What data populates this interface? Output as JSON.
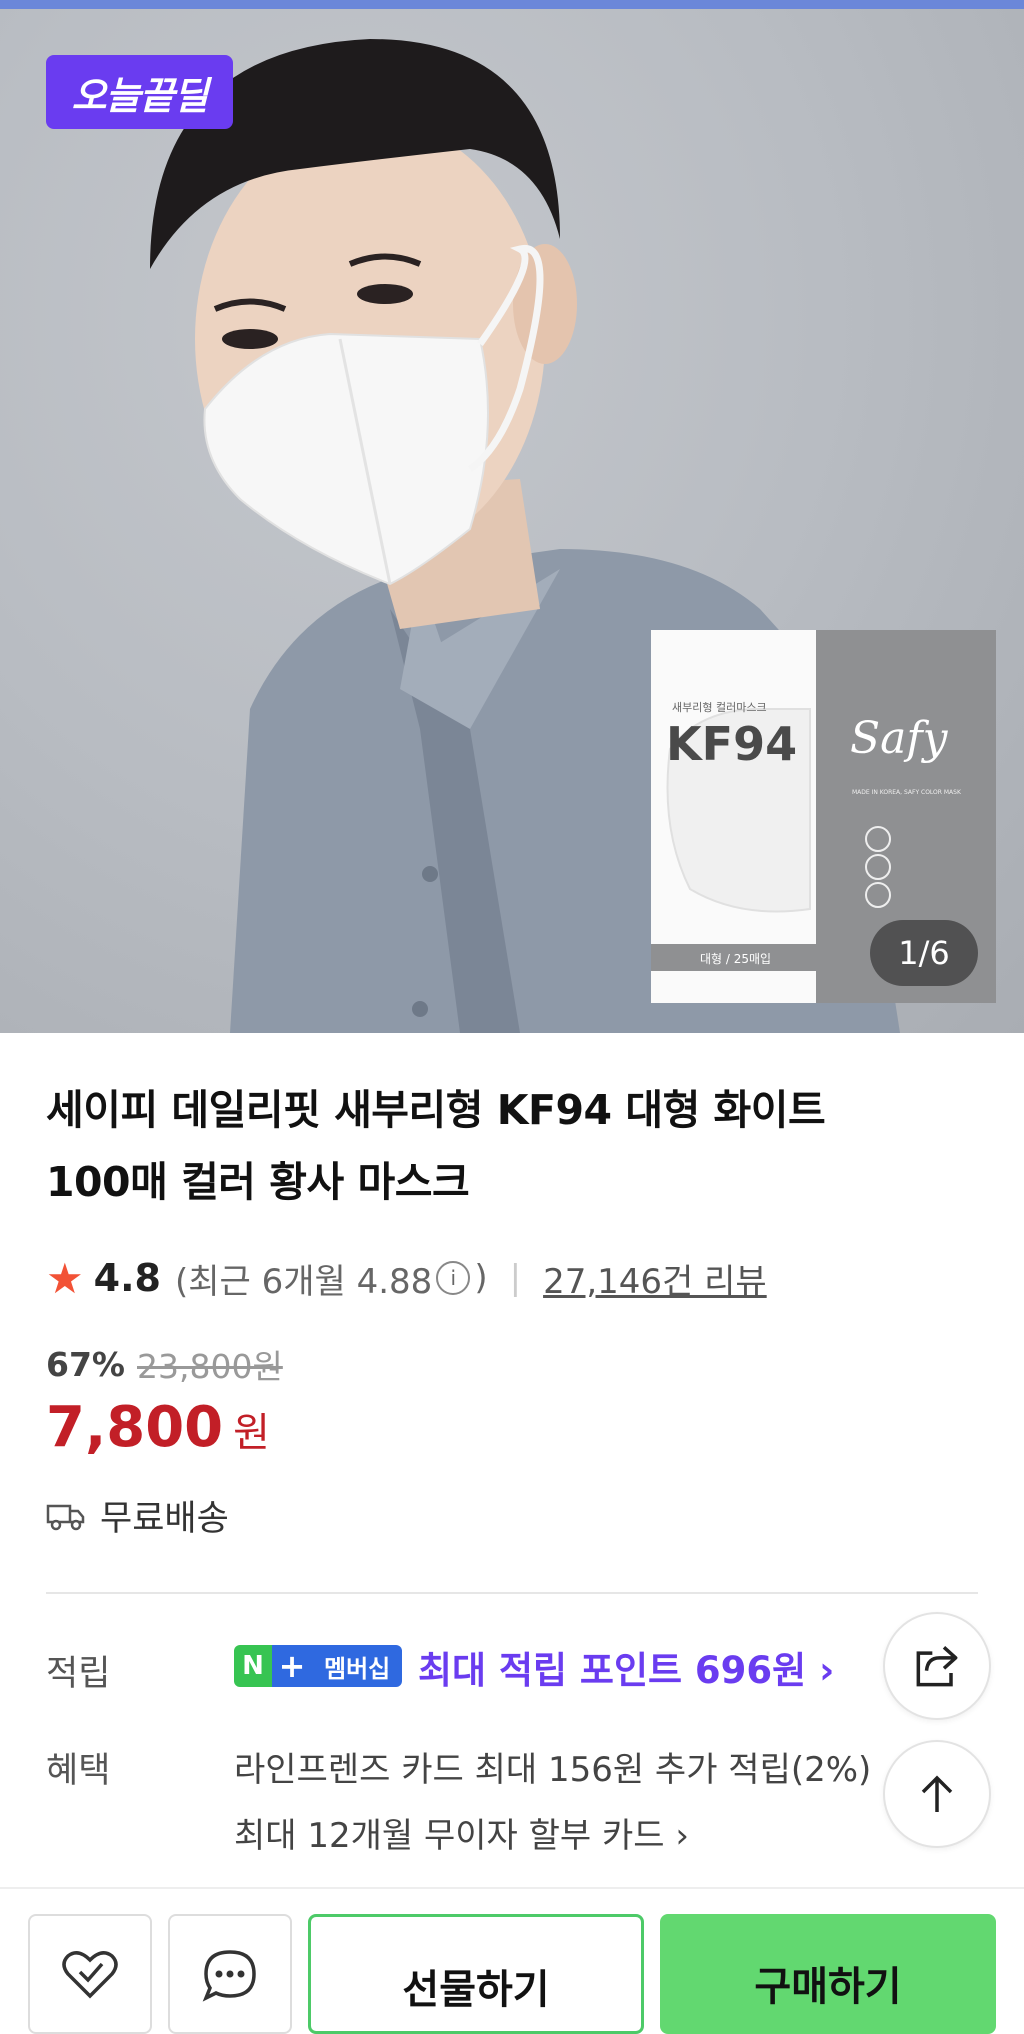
{
  "hero": {
    "badge": "오늘끝딜",
    "pack_brand_label": "새부리형 컬러마스크",
    "pack_model": "KF94",
    "pack_size": "대형 / 25매입",
    "pack_logo": "Safy",
    "pack_tagline": "MADE IN KOREA, SAFY COLOR MASK",
    "image_index": "1/6"
  },
  "product": {
    "title_line1": "세이피 데일리핏 새부리형 KF94 대형 화이트",
    "title_line2": "100매 컬러 황사 마스크"
  },
  "rating": {
    "score": "4.8",
    "recent_text": "(최근 6개월 4.88",
    "recent_close": ")",
    "reviews": "27,146건 리뷰"
  },
  "price": {
    "discount": "67%",
    "original": "23,800원",
    "current": "7,800",
    "unit": "원"
  },
  "shipping": {
    "label": "무료배송"
  },
  "points": {
    "label": "적립",
    "badge_n": "N",
    "badge_plus": "+",
    "badge_membership": "멤버십",
    "text": "최대 적립 포인트 696원 ›"
  },
  "benefits": {
    "label": "혜택",
    "line1": "라인프렌즈 카드 최대 156원 추가 적립(2%)",
    "line2": "최대 12개월 무이자 할부 카드 ›"
  },
  "bottom": {
    "gift_label": "선물하기",
    "buy_label": "구매하기"
  },
  "colors": {
    "accent_purple": "#6a3cf0",
    "price_red": "#c21f27",
    "buy_green": "#62d870",
    "star_red": "#f25236"
  }
}
